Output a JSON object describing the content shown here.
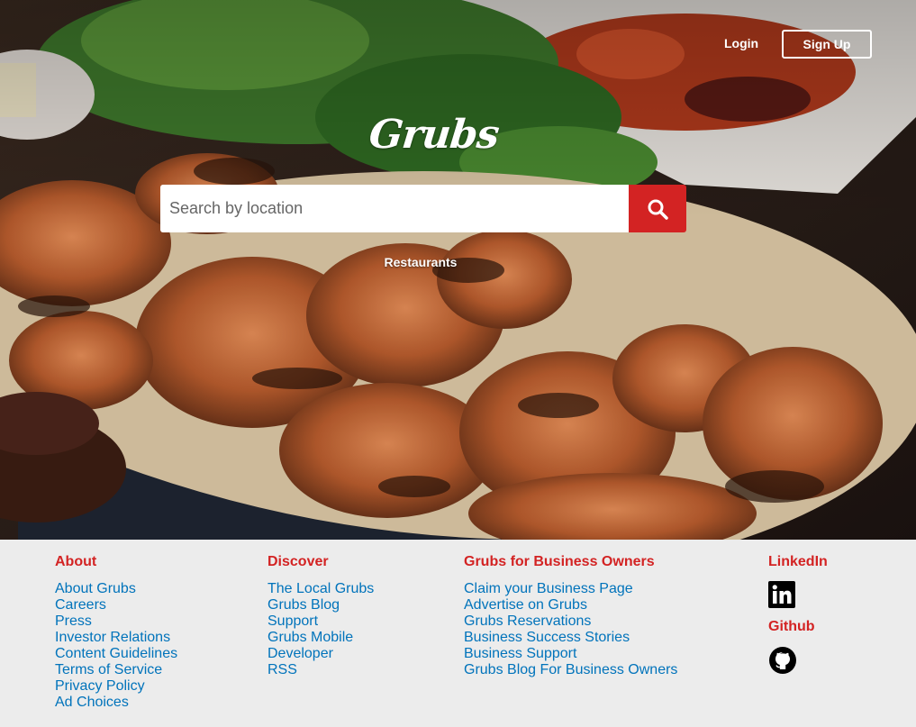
{
  "header": {
    "login_label": "Login",
    "signup_label": "Sign Up",
    "logo_text": "Grubs"
  },
  "search": {
    "placeholder": "Search by location",
    "value": "",
    "button_icon": "search-icon"
  },
  "hero": {
    "category_link": "Restaurants"
  },
  "footer": {
    "about": {
      "heading": "About",
      "links": [
        "About Grubs",
        "Careers",
        "Press",
        "Investor Relations",
        "Content Guidelines",
        "Terms of Service",
        "Privacy Policy",
        "Ad Choices"
      ]
    },
    "discover": {
      "heading": "Discover",
      "links": [
        "The Local Grubs",
        "Grubs Blog",
        "Support",
        "Grubs Mobile",
        "Developer",
        "RSS"
      ]
    },
    "business": {
      "heading": "Grubs for Business Owners",
      "links": [
        "Claim your Business Page",
        "Advertise on Grubs",
        "Grubs Reservations",
        "Business Success Stories",
        "Business Support",
        "Grubs Blog For Business Owners"
      ]
    },
    "social": {
      "linkedin_heading": "LinkedIn",
      "linkedin_icon": "linkedin-icon",
      "github_heading": "Github",
      "github_icon": "github-icon"
    }
  },
  "colors": {
    "brand_red": "#d32323",
    "link_blue": "#0073bb",
    "footer_bg": "#ececec"
  }
}
